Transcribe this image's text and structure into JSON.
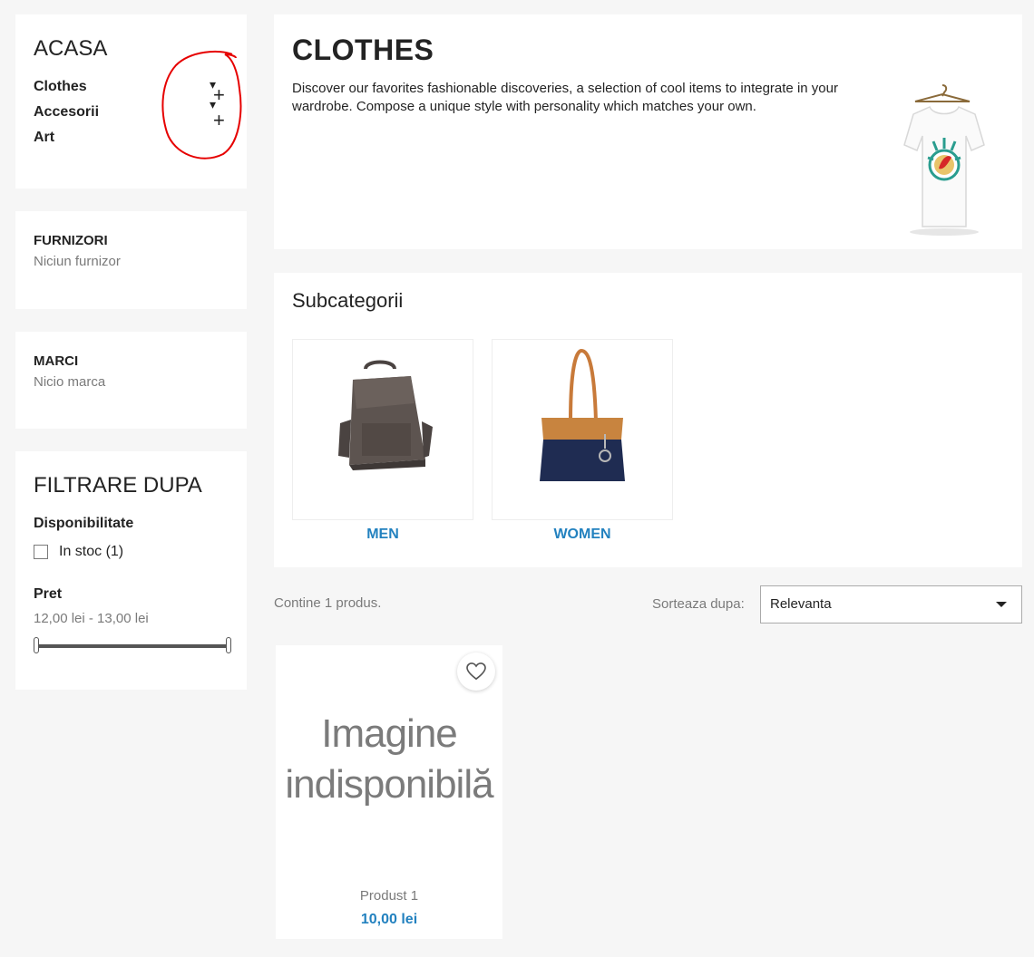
{
  "categories_block": {
    "title": "ACASA",
    "items": [
      {
        "label": "Clothes"
      },
      {
        "label": "Accesorii"
      },
      {
        "label": "Art"
      }
    ],
    "toggle_glyphs": [
      "▾",
      "+",
      "▾",
      "+"
    ]
  },
  "suppliers_block": {
    "title": "FURNIZORI",
    "empty_text": "Niciun furnizor"
  },
  "brands_block": {
    "title": "MARCI",
    "empty_text": "Nicio marca"
  },
  "filters_block": {
    "title": "FILTRARE DUPA",
    "availability": {
      "title": "Disponibilitate",
      "option_label": "In stoc (1)",
      "checked": false
    },
    "price": {
      "title": "Pret",
      "range_text": "12,00 lei - 13,00 lei"
    }
  },
  "category_header": {
    "title": "CLOTHES",
    "description": "Discover our favorites fashionable discoveries, a selection of cool items to integrate in your wardrobe. Compose a unique style with personality which matches your own."
  },
  "subcategories": {
    "title": "Subcategorii",
    "items": [
      {
        "name": "MEN",
        "icon": "backpack-image"
      },
      {
        "name": "WOMEN",
        "icon": "tote-bag-image"
      }
    ]
  },
  "listing": {
    "count_text": "Contine 1 produs.",
    "sort_label": "Sorteaza dupa:",
    "sort_value": "Relevanta"
  },
  "product": {
    "placeholder_line1": "Imagine",
    "placeholder_line2": "indisponibilă",
    "name": "Produst 1",
    "price": "10,00 lei"
  },
  "colors": {
    "accent": "#2281bf",
    "background": "#f6f6f6",
    "annotation": "#e60000"
  }
}
